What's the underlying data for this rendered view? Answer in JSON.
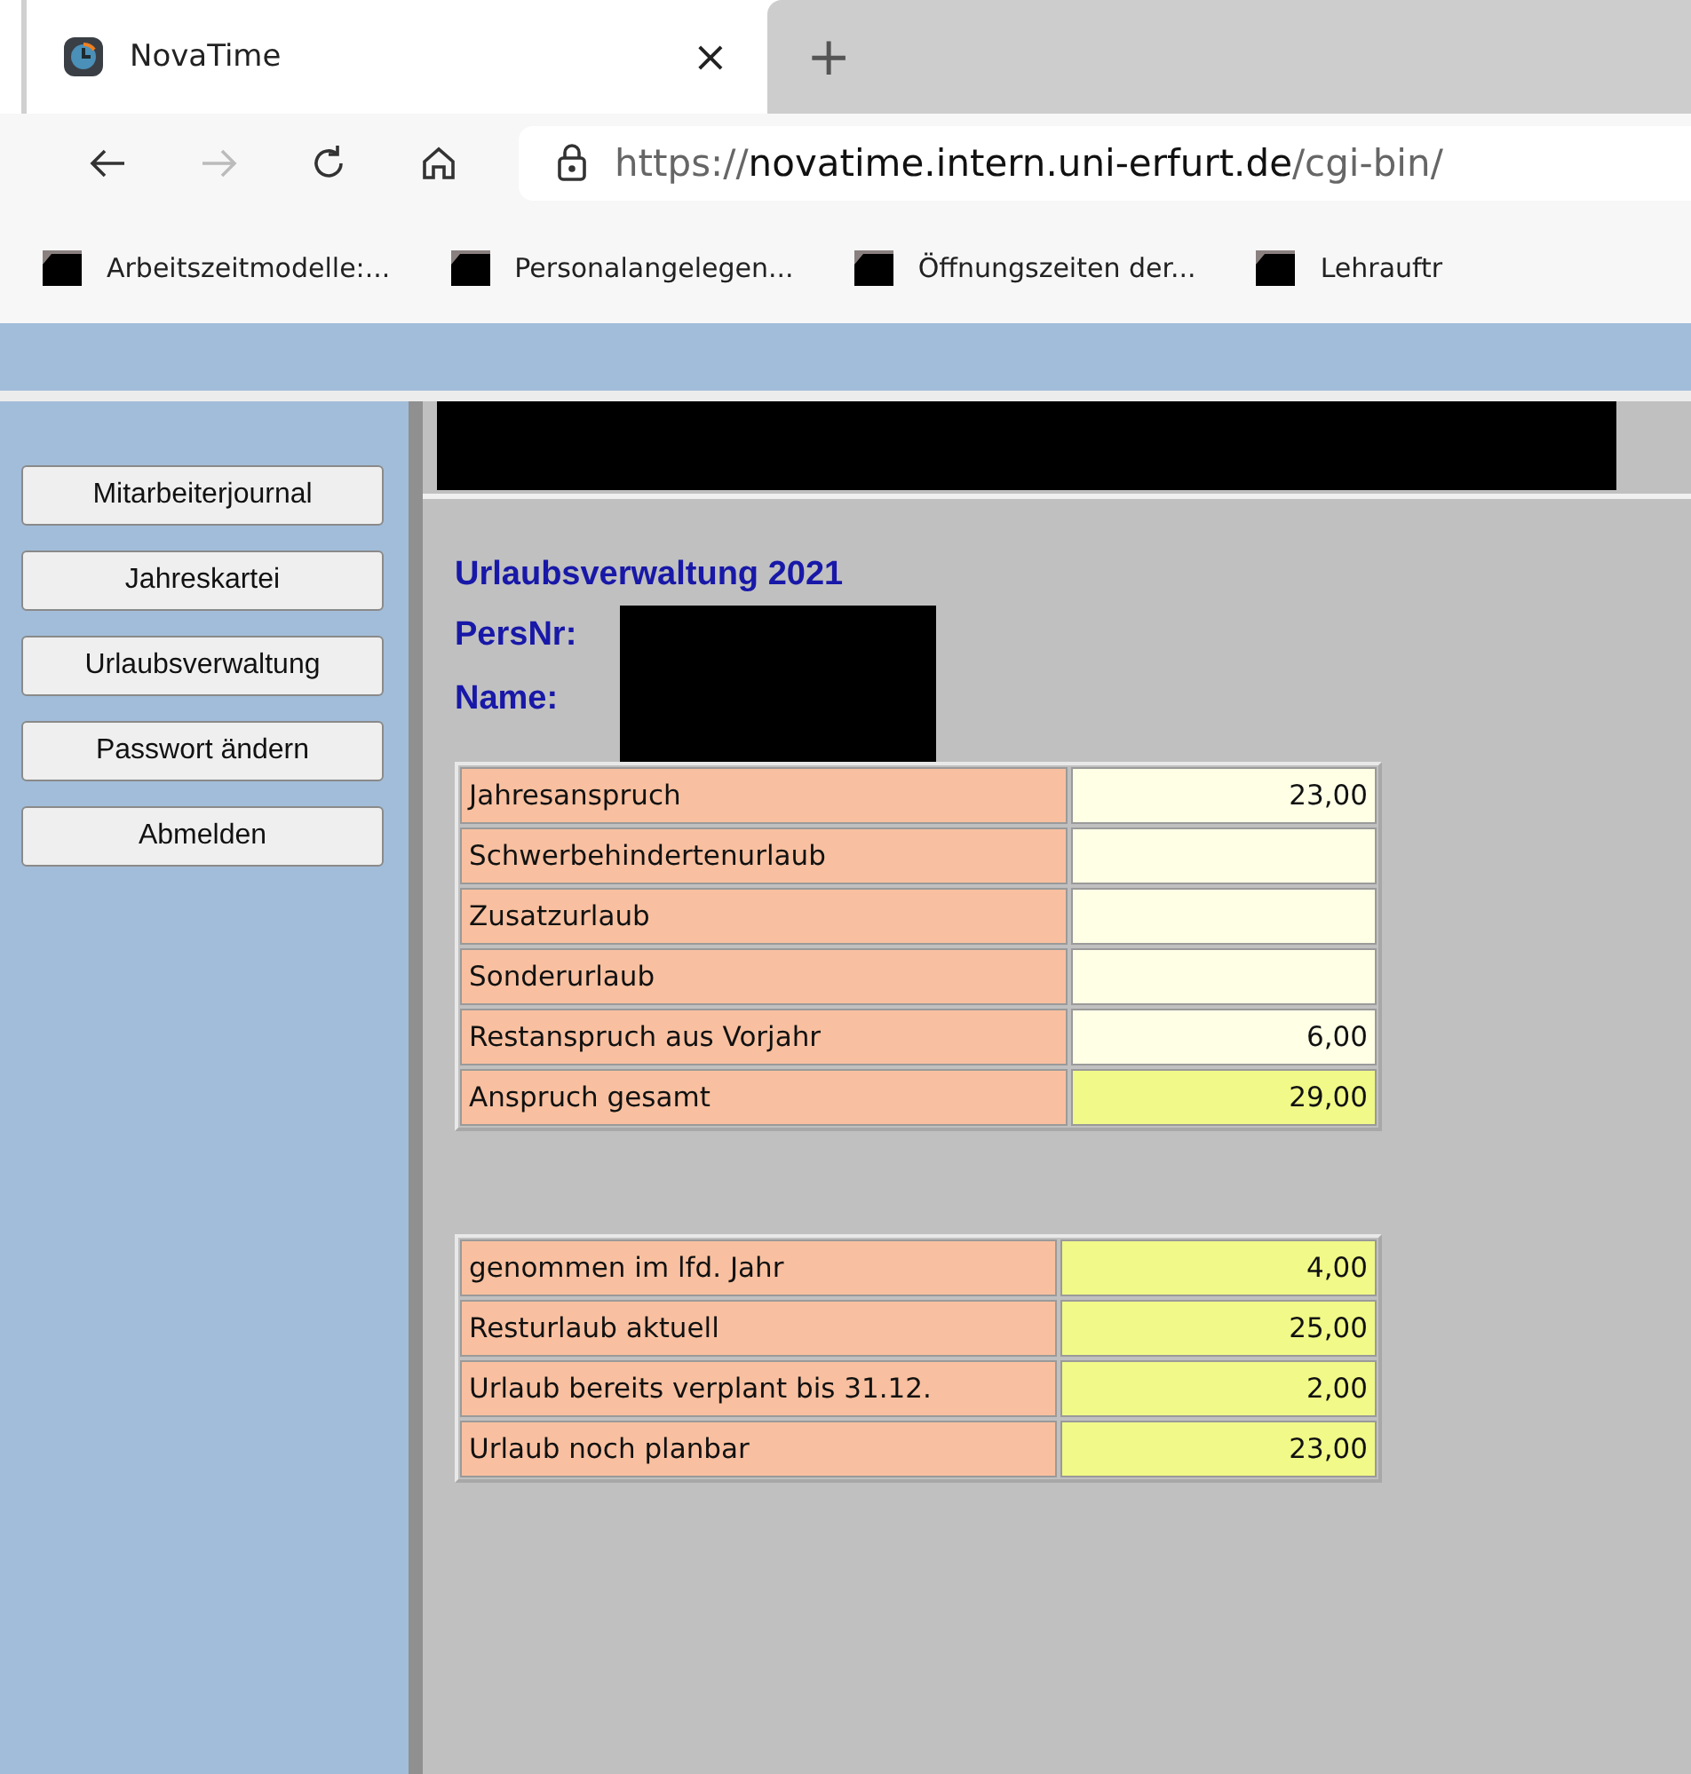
{
  "browser": {
    "tab": {
      "title": "NovaTime",
      "close": "×"
    },
    "new_tab": "+",
    "url": {
      "scheme": "https://",
      "host": "novatime.intern.uni-erfurt.de",
      "path": "/cgi-bin/"
    },
    "bookmarks": [
      "Arbeitszeitmodelle:...",
      "Personalangelegen...",
      "Öffnungszeiten der...",
      "Lehrauftr"
    ]
  },
  "sidebar": {
    "buttons": [
      "Mitarbeiterjournal",
      "Jahreskartei",
      "Urlaubsverwaltung",
      "Passwort ändern",
      "Abmelden"
    ]
  },
  "main": {
    "title": "Urlaubsverwaltung 2021",
    "fields": [
      "PersNr:",
      "Name:"
    ],
    "tables": [
      {
        "rows": [
          {
            "label": "Jahresanspruch",
            "value": "23,00",
            "kind": "entry"
          },
          {
            "label": "Schwerbehindertenurlaub",
            "kind": "entry"
          },
          {
            "label": "Zusatzurlaub",
            "kind": "entry"
          },
          {
            "label": "Sonderurlaub",
            "kind": "entry"
          },
          {
            "label": "Restanspruch aus Vorjahr",
            "value": "6,00",
            "kind": "entry"
          },
          {
            "label": "Anspruch gesamt",
            "value": "29,00",
            "kind": "sum"
          }
        ]
      },
      {
        "rows": [
          {
            "label": "genommen im lfd. Jahr",
            "value": "4,00",
            "kind": "sum"
          },
          {
            "label": "Resturlaub aktuell",
            "value": "25,00",
            "kind": "sum"
          },
          {
            "label": "Urlaub bereits verplant bis 31.12.",
            "value": "2,00",
            "kind": "sum"
          },
          {
            "label": "Urlaub noch planbar",
            "value": "23,00",
            "kind": "sum"
          }
        ]
      }
    ]
  }
}
